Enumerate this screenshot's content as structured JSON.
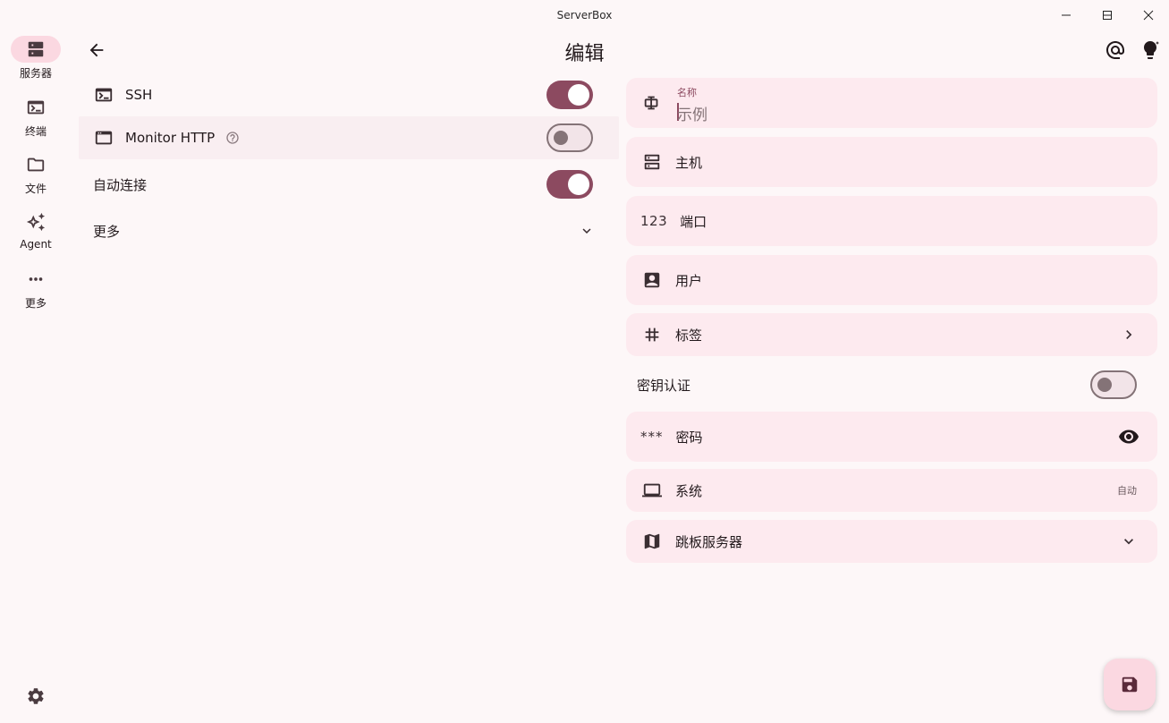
{
  "window": {
    "title": "ServerBox"
  },
  "rail": {
    "items": [
      {
        "label": "服务器",
        "icon": "server-icon",
        "active": true
      },
      {
        "label": "终端",
        "icon": "terminal-icon",
        "active": false
      },
      {
        "label": "文件",
        "icon": "folder-icon",
        "active": false
      },
      {
        "label": "Agent",
        "icon": "sparkle-icon",
        "active": false
      },
      {
        "label": "更多",
        "icon": "more-horiz-icon",
        "active": false
      }
    ],
    "settings_icon": "gear-icon"
  },
  "header": {
    "title": "编辑",
    "back_icon": "arrow-back-icon",
    "right_icons": [
      "at-sign-icon",
      "lightbulb-sparkle-icon"
    ]
  },
  "left": {
    "ssh": {
      "label": "SSH",
      "enabled": true
    },
    "monitor_http": {
      "label": "Monitor HTTP",
      "enabled": false
    },
    "auto_connect": {
      "label": "自动连接",
      "enabled": true
    },
    "more": {
      "label": "更多"
    }
  },
  "right": {
    "name": {
      "label": "名称",
      "placeholder": "示例"
    },
    "host": {
      "label": "主机"
    },
    "port": {
      "label": "端口",
      "icon_text": "123"
    },
    "user": {
      "label": "用户"
    },
    "tags": {
      "label": "标签"
    },
    "key_auth": {
      "label": "密钥认证",
      "enabled": false
    },
    "password": {
      "label": "密码",
      "icon_text": "***"
    },
    "system": {
      "label": "系统",
      "value": "自动"
    },
    "jump_server": {
      "label": "跳板服务器"
    }
  },
  "fab": {
    "icon": "save-icon"
  },
  "colors": {
    "background": "#fdf7f8",
    "card": "#fdeaef",
    "primary": "#8c4a60",
    "rail_active": "#fbd8e1",
    "outline": "#847377"
  }
}
